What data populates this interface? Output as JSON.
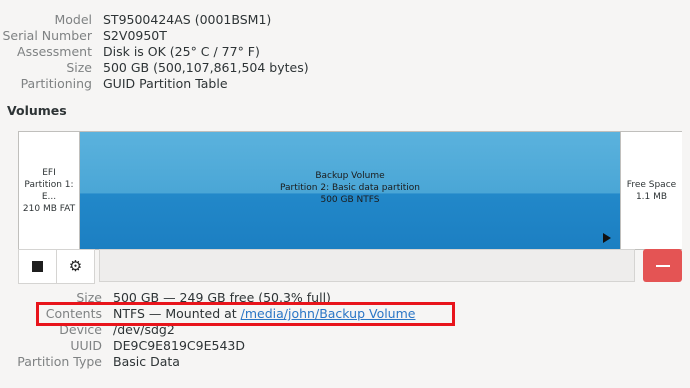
{
  "drive": {
    "model_label": "Model",
    "model": "ST9500424AS (0001BSM1)",
    "serial_label": "Serial Number",
    "serial": "S2V0950T",
    "assessment_label": "Assessment",
    "assessment": "Disk is OK (25° C / 77° F)",
    "size_label": "Size",
    "size": "500 GB (500,107,861,504 bytes)",
    "partitioning_label": "Partitioning",
    "partitioning": "GUID Partition Table"
  },
  "volumes": {
    "heading": "Volumes",
    "partitions": [
      {
        "line1": "EFI",
        "line2": "Partition 1: E...",
        "line3": "210 MB FAT",
        "selected": false
      },
      {
        "line1": "Backup Volume",
        "line2": "Partition 2: Basic data partition",
        "line3": "500 GB NTFS",
        "selected": true
      },
      {
        "line1": "Free Space",
        "line2": "1.1 MB",
        "selected": false
      }
    ]
  },
  "toolbar": {
    "stop_icon": "stop-icon",
    "settings_icon": "gear-icon",
    "delete_icon": "minus-icon",
    "delete_color": "#e45454"
  },
  "volume_details": {
    "size_label": "Size",
    "size": "500 GB — 249 GB free (50.3% full)",
    "contents_label": "Contents",
    "contents_prefix": "NTFS — Mounted at ",
    "contents_link": "/media/john/Backup Volume",
    "device_label": "Device",
    "device": "/dev/sdg2",
    "uuid_label": "UUID",
    "uuid": "DE9C9E819C9E543D",
    "partition_type_label": "Partition Type",
    "partition_type": "Basic Data"
  },
  "annotation": {
    "highlight_color": "#e8141b"
  }
}
